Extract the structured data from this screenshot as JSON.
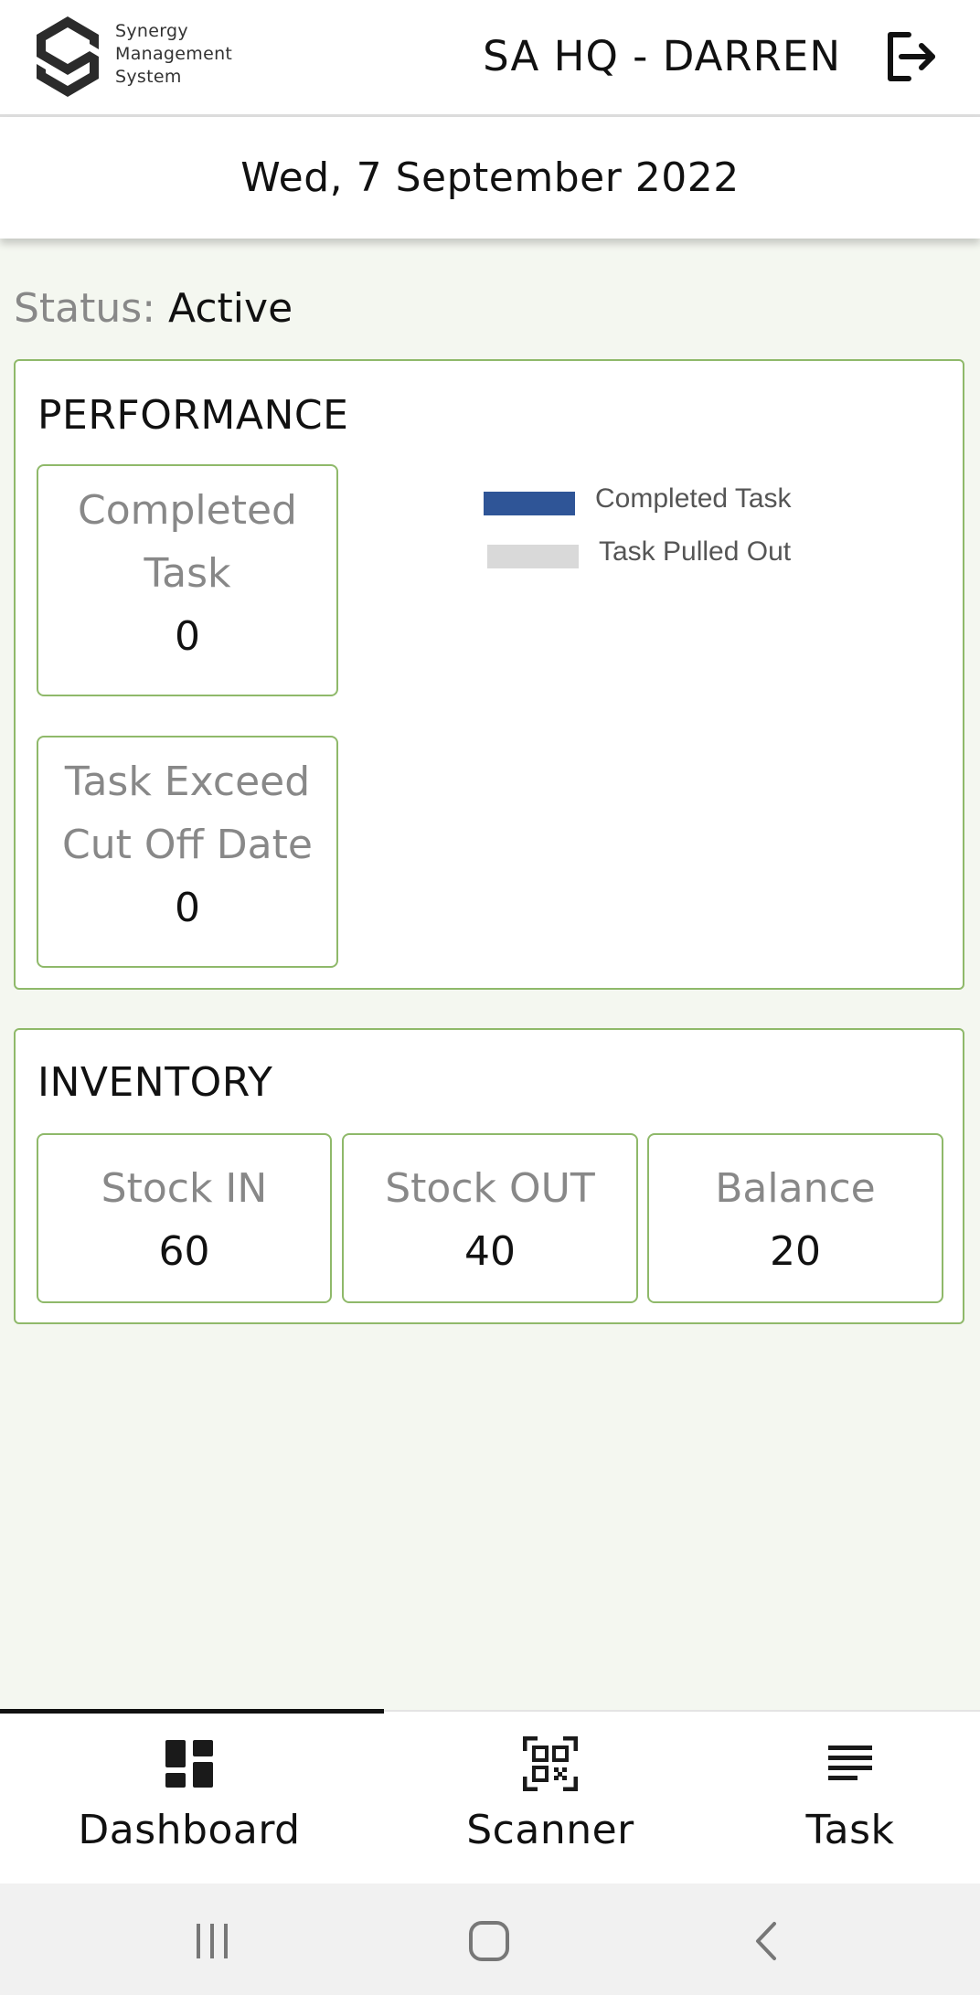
{
  "header": {
    "logo_lines": [
      "Synergy",
      "Management",
      "System"
    ],
    "user_title": "SA HQ - DARREN",
    "logout_icon": "logout-icon"
  },
  "date": "Wed, 7 September 2022",
  "status": {
    "label": "Status:",
    "value": "Active"
  },
  "performance": {
    "title": "PERFORMANCE",
    "boxes": [
      {
        "label_lines": [
          "Completed",
          "Task"
        ],
        "value": "0"
      },
      {
        "label_lines": [
          "Task Exceed",
          "Cut Off Date"
        ],
        "value": "0"
      }
    ],
    "legend": [
      {
        "label": "Completed Task",
        "color": "#2f5597"
      },
      {
        "label": "Task Pulled Out",
        "color": "#d9d9d9"
      }
    ]
  },
  "inventory": {
    "title": "INVENTORY",
    "boxes": [
      {
        "label": "Stock IN",
        "value": "60"
      },
      {
        "label": "Stock OUT",
        "value": "40"
      },
      {
        "label": "Balance",
        "value": "20"
      }
    ]
  },
  "nav": {
    "tabs": [
      {
        "label": "Dashboard",
        "icon": "dashboard-icon",
        "active": true
      },
      {
        "label": "Scanner",
        "icon": "qr-code-icon",
        "active": false
      },
      {
        "label": "Task",
        "icon": "list-icon",
        "active": false
      }
    ]
  },
  "system_bar": {
    "buttons": [
      "recent-apps-icon",
      "home-icon",
      "back-icon"
    ]
  },
  "colors": {
    "accent_border": "#8fb96a",
    "background": "#f4f7f0",
    "legend_completed": "#2f5597",
    "legend_pulled_out": "#d9d9d9"
  }
}
